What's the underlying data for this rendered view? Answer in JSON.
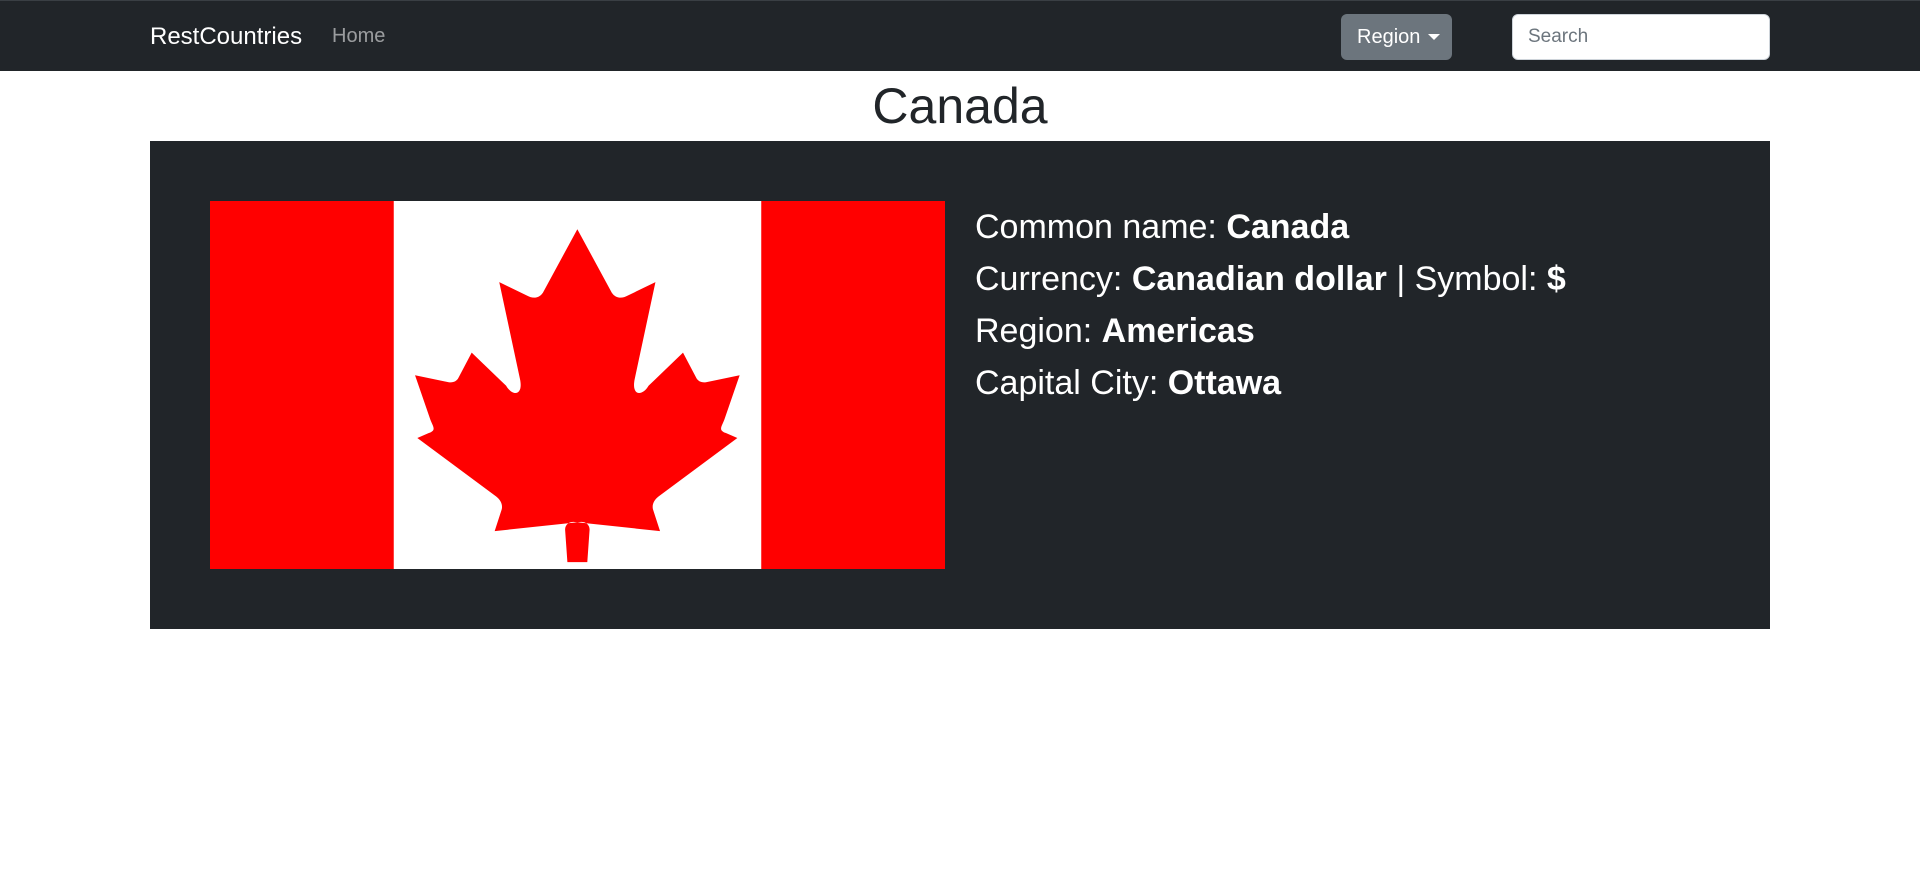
{
  "navbar": {
    "brand": "RestCountries",
    "home_label": "Home",
    "region_label": "Region",
    "search_placeholder": "Search",
    "search_value": ""
  },
  "page": {
    "title": "Canada"
  },
  "country": {
    "flag_alt": "Canada flag",
    "flag_colors": {
      "red": "#ff0000",
      "white": "#ffffff"
    },
    "common_name_label": "Common name: ",
    "common_name": "Canada",
    "currency_label": "Currency: ",
    "currency": "Canadian dollar",
    "symbol_separator": " | Symbol: ",
    "symbol": "$",
    "region_label": "Region: ",
    "region": "Americas",
    "capital_label": "Capital City: ",
    "capital": "Ottawa"
  },
  "theme": {
    "navbar_bg": "#212529",
    "card_bg": "#212529",
    "button_bg": "#6c757d"
  }
}
